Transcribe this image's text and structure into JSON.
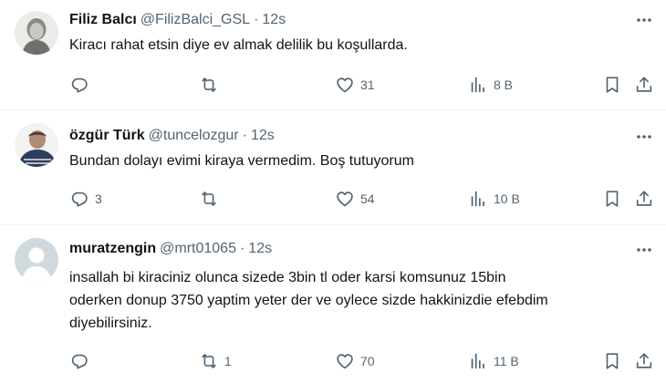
{
  "tweets": [
    {
      "name": "Filiz Balcı",
      "handle": "@FilizBalci_GSL",
      "dot": "·",
      "time": "12s",
      "text": "Kiracı rahat etsin diye ev almak delilik bu koşullarda.",
      "replies": "",
      "retweets": "",
      "likes": "31",
      "views": "8 B"
    },
    {
      "name": "özgür Türk",
      "handle": "@tuncelozgur",
      "dot": "·",
      "time": "12s",
      "text": "Bundan dolayı evimi kiraya vermedim. Boş tutuyorum",
      "replies": "3",
      "retweets": "",
      "likes": "54",
      "views": "10 B"
    },
    {
      "name": "muratzengin",
      "handle": "@mrt01065",
      "dot": "·",
      "time": "12s",
      "text": "insallah bi kiraciniz olunca sizede 3bin tl oder karsi komsunuz 15bin\noderken donup  3750 yaptim yeter der ve oylece sizde hakkinizdie efebdim\ndiyebilirsiniz.",
      "replies": "",
      "retweets": "1",
      "likes": "70",
      "views": "11 B"
    }
  ],
  "icons": {
    "more": "more-icon",
    "reply": "reply-icon",
    "retweet": "retweet-icon",
    "like": "heart-icon",
    "views": "views-icon",
    "bookmark": "bookmark-icon",
    "share": "share-icon"
  },
  "colors": {
    "text": "#0f1419",
    "muted": "#536471",
    "divider": "#eff3f4",
    "default_avatar_bg": "#cfd9de"
  }
}
